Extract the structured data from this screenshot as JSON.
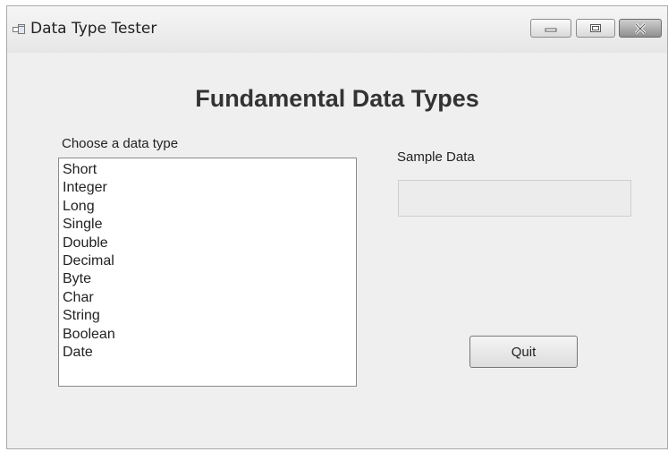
{
  "window": {
    "title": "Data Type Tester",
    "icon": "form-icon"
  },
  "title_bar_buttons": {
    "minimize_icon": "minimize-icon",
    "maximize_icon": "maximize-icon",
    "close_icon": "close-icon"
  },
  "form": {
    "heading": "Fundamental Data Types",
    "list_label": "Choose a data type",
    "list_items": [
      "Short",
      "Integer",
      "Long",
      "Single",
      "Double",
      "Decimal",
      "Byte",
      "Char",
      "String",
      "Boolean",
      "Date"
    ],
    "sample_label": "Sample Data",
    "sample_value": "",
    "quit_label": "Quit"
  }
}
